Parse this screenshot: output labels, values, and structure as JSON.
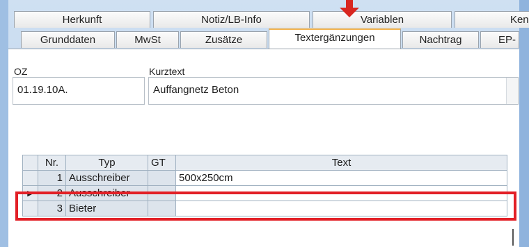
{
  "tabs_back": [
    "Herkunft",
    "Notiz/LB-Info",
    "Variablen",
    "Kenn"
  ],
  "tabs_front": [
    "Grunddaten",
    "MwSt",
    "Zusätze",
    "Textergänzungen",
    "Nachtrag",
    "EP-"
  ],
  "active_tab": "Textergänzungen",
  "form": {
    "oz_label": "OZ",
    "oz_value": "01.19.10A.",
    "kurztext_label": "Kurztext",
    "kurztext_value": "Auffangnetz Beton"
  },
  "grid": {
    "columns": [
      "Nr.",
      "Typ",
      "GT",
      "Text"
    ],
    "rows": [
      {
        "marker": "",
        "nr": "1",
        "typ": "Ausschreiber",
        "gt": "",
        "text": "500x250cm"
      },
      {
        "marker": "▶",
        "nr": "2",
        "typ": "Ausschreiber",
        "gt": "",
        "text": ""
      },
      {
        "marker": "",
        "nr": "3",
        "typ": "Bieter",
        "gt": "",
        "text": ""
      }
    ]
  },
  "colors": {
    "highlight": "#e21f26",
    "active_tab_accent": "#f4b24a",
    "arrow": "#d8261f"
  }
}
